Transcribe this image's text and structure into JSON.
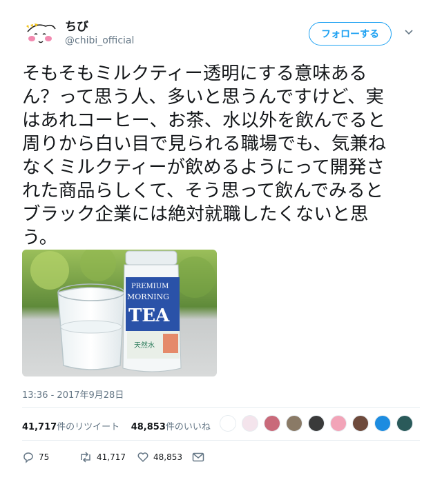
{
  "user": {
    "display_name": "ちび",
    "handle": "@chibi_official"
  },
  "follow_button": {
    "label": "フォローする"
  },
  "tweet": {
    "lines": [
      "そもそもミルクティー透明にする意味ある",
      "ん？って思う人、多いと思うんですけど、実",
      "はあれコーヒー、お茶、水以外を飲んでると",
      "周りから白い目で見られる職場でも、気兼ね",
      "なくミルクティーが飲めるようにって開発さ",
      "れた商品らしくて、そう思って飲んでみると",
      "ブラック企業には絶対就職したくないと思",
      "う。"
    ],
    "timestamp": "13:36 - 2017年9月28日"
  },
  "photo": {
    "bottle_brand_top": "PREMIUM",
    "bottle_brand_mid": "MORNING",
    "bottle_brand_big": "TEA",
    "bottle_small_text": "天然水"
  },
  "stats": {
    "retweets_count": "41,717",
    "retweets_label": "件のリツイート",
    "likes_count": "48,853",
    "likes_label": "件のいいね"
  },
  "liker_avatars": [
    {
      "name": "avatar-1",
      "color": "#ffffff"
    },
    {
      "name": "avatar-2",
      "color": "#f4e4ec"
    },
    {
      "name": "avatar-3",
      "color": "#c96a7a"
    },
    {
      "name": "avatar-4",
      "color": "#8a7a66"
    },
    {
      "name": "avatar-5",
      "color": "#3a3a3a"
    },
    {
      "name": "avatar-6",
      "color": "#f2a4b8"
    },
    {
      "name": "avatar-7",
      "color": "#6e4a3c"
    },
    {
      "name": "avatar-8",
      "color": "#1d8ce0"
    },
    {
      "name": "avatar-9",
      "color": "#2a5a5a"
    }
  ],
  "actions": {
    "replies": "75",
    "retweets": "41,717",
    "likes": "48,853"
  },
  "colors": {
    "accent": "#1da1f2",
    "secondary_text": "#657786",
    "divider": "#e6ecf0"
  },
  "icons": [
    "avatar-character",
    "chevron-down-icon",
    "reply-icon",
    "retweet-icon",
    "like-icon",
    "message-icon"
  ]
}
